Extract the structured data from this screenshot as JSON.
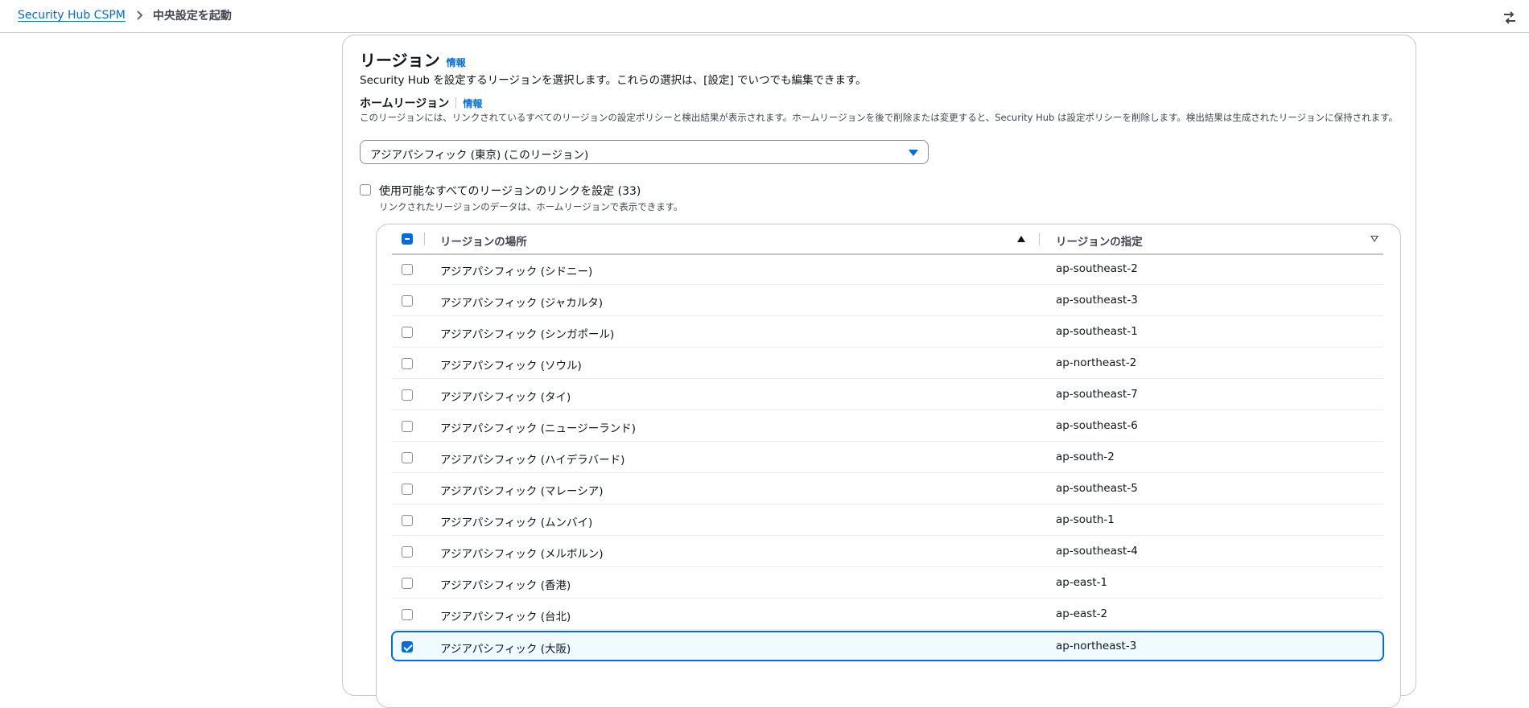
{
  "breadcrumb": {
    "parent": "Security Hub CSPM",
    "current": "中央設定を起動"
  },
  "section": {
    "title": "リージョン",
    "info": "情報",
    "description": "Security Hub を設定するリージョンを選択します。これらの選択は、[設定] でいつでも編集できます。"
  },
  "home_region": {
    "label": "ホームリージョン",
    "info": "情報",
    "description": "このリージョンには、リンクされているすべてのリージョンの設定ポリシーと検出結果が表示されます。ホームリージョンを後で削除または変更すると、Security Hub は設定ポリシーを削除します。検出結果は生成されたリージョンに保持されます。",
    "selected_value": "アジアパシフィック (東京) (このリージョン)"
  },
  "link_all": {
    "label": "使用可能なすべてのリージョンのリンクを設定 (33)",
    "description": "リンクされたリージョンのデータは、ホームリージョンで表示できます。",
    "checked": false
  },
  "table": {
    "columns": [
      "リージョンの場所",
      "リージョンの指定"
    ],
    "header_checkbox_state": "indeterminate",
    "rows": [
      {
        "name": "アジアパシフィック (シドニー)",
        "code": "ap-southeast-2",
        "checked": false
      },
      {
        "name": "アジアパシフィック (ジャカルタ)",
        "code": "ap-southeast-3",
        "checked": false
      },
      {
        "name": "アジアパシフィック (シンガポール)",
        "code": "ap-southeast-1",
        "checked": false
      },
      {
        "name": "アジアパシフィック (ソウル)",
        "code": "ap-northeast-2",
        "checked": false
      },
      {
        "name": "アジアパシフィック (タイ)",
        "code": "ap-southeast-7",
        "checked": false
      },
      {
        "name": "アジアパシフィック (ニュージーランド)",
        "code": "ap-southeast-6",
        "checked": false
      },
      {
        "name": "アジアパシフィック (ハイデラバード)",
        "code": "ap-south-2",
        "checked": false
      },
      {
        "name": "アジアパシフィック (マレーシア)",
        "code": "ap-southeast-5",
        "checked": false
      },
      {
        "name": "アジアパシフィック (ムンバイ)",
        "code": "ap-south-1",
        "checked": false
      },
      {
        "name": "アジアパシフィック (メルボルン)",
        "code": "ap-southeast-4",
        "checked": false
      },
      {
        "name": "アジアパシフィック (香港)",
        "code": "ap-east-1",
        "checked": false
      },
      {
        "name": "アジアパシフィック (台北)",
        "code": "ap-east-2",
        "checked": false
      },
      {
        "name": "アジアパシフィック (大阪)",
        "code": "ap-northeast-3",
        "checked": true
      }
    ]
  },
  "colors": {
    "accent": "#006ce0",
    "border": "#c6c6cd",
    "selected_row_bg": "#f0fbff"
  }
}
